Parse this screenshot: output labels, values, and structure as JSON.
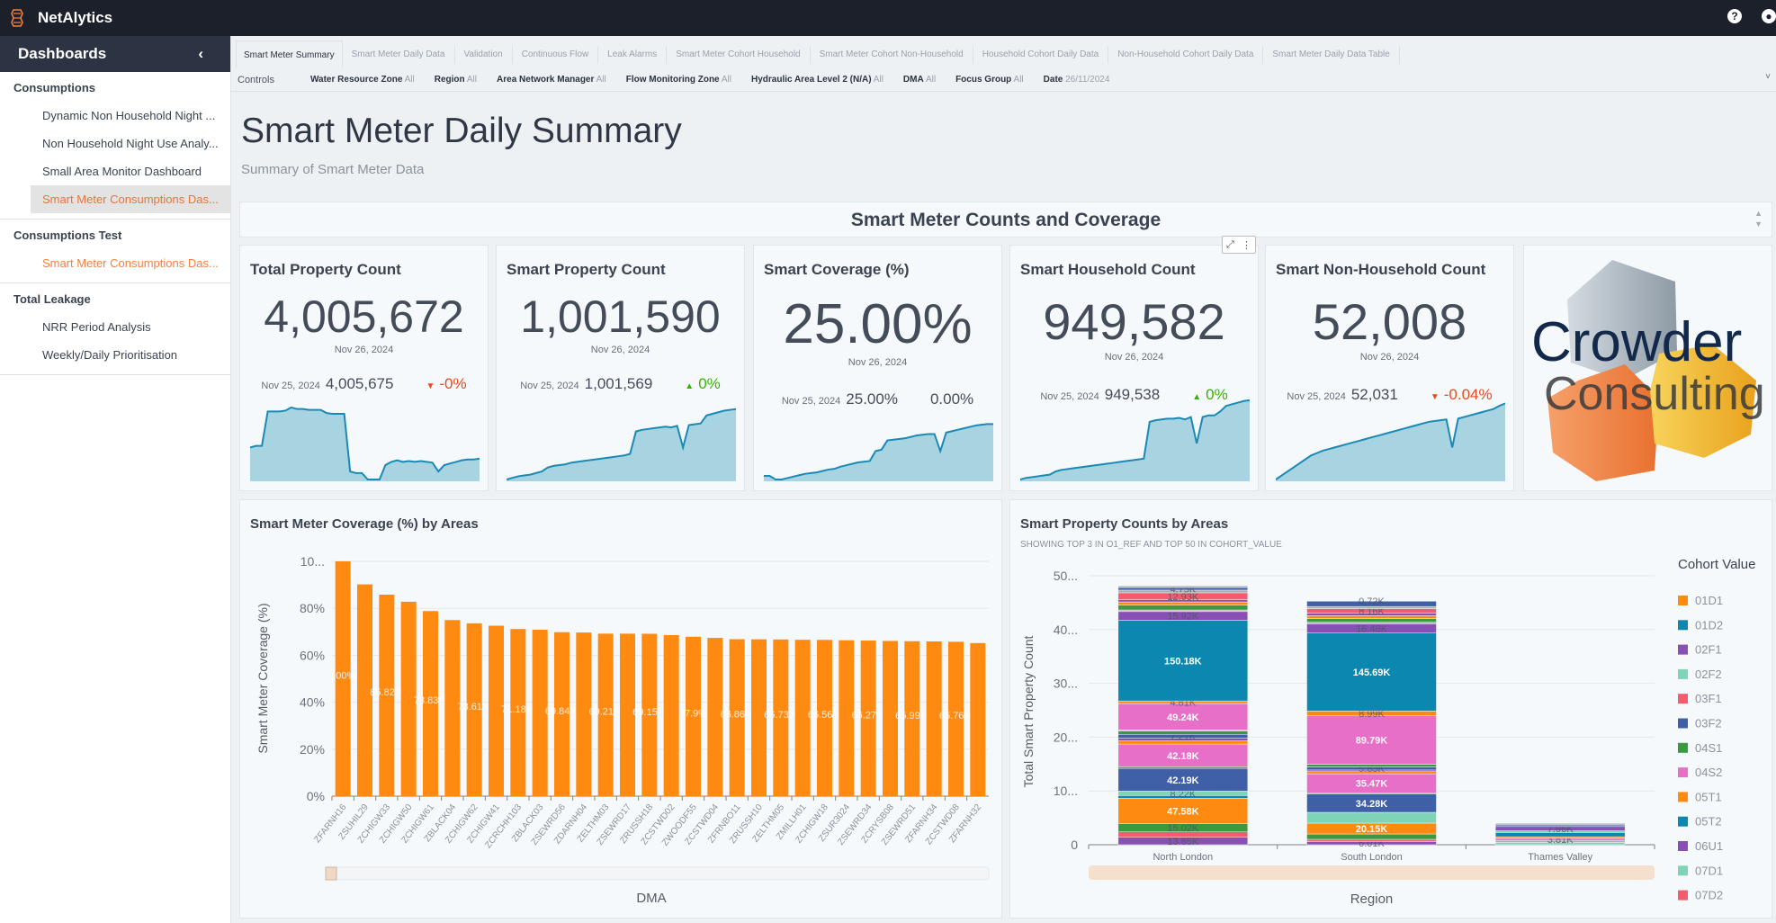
{
  "app": {
    "name": "NetAlytics",
    "help_icon": "question-circle-icon",
    "user_icon": "user-circle-icon"
  },
  "sidebar": {
    "title": "Dashboards",
    "groups": [
      {
        "title": "Consumptions",
        "items": [
          {
            "label": "Dynamic Non Household Night ..."
          },
          {
            "label": "Non Household Night Use Analy..."
          },
          {
            "label": "Small Area Monitor Dashboard"
          },
          {
            "label": "Smart Meter Consumptions Das...",
            "active": true
          }
        ]
      },
      {
        "title": "Consumptions Test",
        "items": [
          {
            "label": "Smart Meter Consumptions Das...",
            "highlight": true
          }
        ]
      },
      {
        "title": "Total Leakage",
        "items": [
          {
            "label": "NRR Period Analysis"
          },
          {
            "label": "Weekly/Daily Prioritisation"
          }
        ]
      }
    ]
  },
  "tabs": [
    {
      "label": "Smart Meter Summary",
      "active": true
    },
    {
      "label": "Smart Meter Daily Data"
    },
    {
      "label": "Validation"
    },
    {
      "label": "Continuous Flow"
    },
    {
      "label": "Leak Alarms"
    },
    {
      "label": "Smart Meter Cohort Household"
    },
    {
      "label": "Smart Meter Cohort Non-Household"
    },
    {
      "label": "Household Cohort Daily Data"
    },
    {
      "label": "Non-Household Cohort Daily Data"
    },
    {
      "label": "Smart Meter Daily Data Table"
    }
  ],
  "controls": {
    "label": "Controls",
    "filters": [
      {
        "name": "Water Resource Zone",
        "value": "All"
      },
      {
        "name": "Region",
        "value": "All"
      },
      {
        "name": "Area Network Manager",
        "value": "All"
      },
      {
        "name": "Flow Monitoring Zone",
        "value": "All"
      },
      {
        "name": "Hydraulic Area Level 2 (N/A)",
        "value": "All"
      },
      {
        "name": "DMA",
        "value": "All"
      },
      {
        "name": "Focus Group",
        "value": "All"
      },
      {
        "name": "Date",
        "value": "26/11/2024"
      }
    ]
  },
  "page": {
    "title": "Smart Meter Daily Summary",
    "subtitle": "Summary of Smart Meter Data",
    "section": "Smart Meter Counts and Coverage"
  },
  "colors": {
    "accent": "#f5803e",
    "spark_line": "#1a8ab5",
    "spark_fill": "#a8d3e0",
    "bar": "#fe8a11",
    "down": "#e8491d",
    "up": "#36b300"
  },
  "kpis": [
    {
      "title": "Total Property Count",
      "value": "4,005,672",
      "date": "Nov 26, 2024",
      "prev_date": "Nov 25, 2024",
      "prev_value": "4,005,675",
      "change": "-0%",
      "dir": "down",
      "trend": [
        40,
        42,
        42,
        85,
        85,
        85,
        86,
        90,
        88,
        88,
        87,
        87,
        87,
        83,
        82,
        82,
        82,
        10,
        8,
        8,
        0,
        0,
        0,
        18,
        22,
        24,
        22,
        23,
        22,
        23,
        22,
        21,
        10,
        18,
        20,
        22,
        24,
        25,
        25,
        26
      ]
    },
    {
      "title": "Smart Property Count",
      "value": "1,001,590",
      "date": "Nov 26, 2024",
      "prev_date": "Nov 25, 2024",
      "prev_value": "1,001,569",
      "change": "0%",
      "dir": "up",
      "trend": [
        0,
        2,
        4,
        5,
        6,
        8,
        10,
        15,
        17,
        18,
        19,
        21,
        22,
        23,
        24,
        25,
        26,
        27,
        28,
        29,
        30,
        32,
        60,
        62,
        63,
        64,
        65,
        66,
        65,
        67,
        40,
        68,
        69,
        70,
        80,
        82,
        84,
        86,
        87,
        88
      ]
    },
    {
      "title": "Smart Coverage (%)",
      "value": "25.00%",
      "date": "Nov 26, 2024",
      "prev_date": "Nov 25, 2024",
      "prev_value": "25.00%",
      "change": "0.00%",
      "dir": "flat",
      "trend": [
        5,
        5,
        0,
        0,
        2,
        4,
        6,
        8,
        9,
        10,
        12,
        14,
        15,
        18,
        20,
        22,
        24,
        25,
        26,
        40,
        42,
        55,
        56,
        57,
        58,
        60,
        62,
        63,
        64,
        64,
        40,
        66,
        68,
        70,
        72,
        74,
        76,
        77,
        78,
        78
      ]
    },
    {
      "title": "Smart Household Count",
      "value": "949,582",
      "date": "Nov 26, 2024",
      "prev_date": "Nov 25, 2024",
      "prev_value": "949,538",
      "change": "0%",
      "dir": "up",
      "trend": [
        0,
        2,
        3,
        4,
        5,
        6,
        10,
        12,
        13,
        14,
        15,
        16,
        17,
        18,
        19,
        20,
        21,
        22,
        23,
        24,
        25,
        26,
        72,
        74,
        75,
        76,
        76,
        77,
        75,
        78,
        45,
        78,
        80,
        80,
        85,
        92,
        94,
        96,
        98,
        99
      ]
    },
    {
      "title": "Smart Non-Household Count",
      "value": "52,008",
      "date": "Nov 26, 2024",
      "prev_date": "Nov 25, 2024",
      "prev_value": "52,031",
      "change": "-0.04%",
      "dir": "down",
      "trend": [
        0,
        5,
        10,
        15,
        20,
        25,
        30,
        33,
        36,
        38,
        40,
        42,
        44,
        46,
        48,
        50,
        52,
        54,
        56,
        58,
        60,
        62,
        64,
        66,
        68,
        70,
        72,
        73,
        74,
        75,
        40,
        76,
        78,
        80,
        82,
        84,
        86,
        88,
        92,
        95
      ]
    }
  ],
  "logo": {
    "text_line1": "Crowder",
    "text_line2": "Consulting"
  },
  "chart_data": [
    {
      "type": "bar",
      "title": "Smart Meter Coverage (%) by Areas",
      "xlabel": "DMA",
      "ylabel": "Smart Meter Coverage (%)",
      "ylim": [
        0,
        100
      ],
      "yticks": [
        "0%",
        "20%",
        "40%",
        "60%",
        "80%",
        "10..."
      ],
      "grid": true,
      "categories": [
        "ZFARNH16",
        "ZSUHIL29",
        "ZCHIGW33",
        "ZCHIGW50",
        "ZCHIGW61",
        "ZBLACK04",
        "ZCHIGW62",
        "ZCHIGW41",
        "ZCRCHH103",
        "ZBLACK03",
        "ZSEWRD56",
        "ZDARNH04",
        "ZELTHM03",
        "ZSEWRD17",
        "ZRUSSH18",
        "ZCSTWD02",
        "ZWOODF55",
        "ZCSTWD04",
        "ZFRNBO11",
        "ZRUSSH10",
        "ZELTHM05",
        "ZMILLH01",
        "ZCHIGW18",
        "ZSUR3024",
        "ZSEWRD34",
        "ZCRYSB08",
        "ZSEWRD51",
        "ZFARNH34",
        "ZCSTWD08",
        "ZFARNH32"
      ],
      "values": [
        100,
        90.2,
        85.82,
        82.8,
        78.83,
        75.0,
        73.61,
        72.6,
        71.18,
        70.9,
        69.84,
        69.7,
        69.21,
        69.2,
        69.15,
        68.6,
        67.9,
        67.4,
        66.86,
        66.8,
        66.73,
        66.6,
        66.56,
        66.4,
        66.27,
        66.1,
        65.99,
        65.9,
        65.76,
        65.2
      ],
      "data_labels": [
        "100%",
        "",
        "85.82%",
        "",
        "78.83%",
        "",
        "73.61%",
        "",
        "71.18%",
        "",
        "69.84%",
        "",
        "69.21%",
        "",
        "69.15%",
        "",
        "67.9%",
        "",
        "66.86%",
        "",
        "66.73%",
        "",
        "66.56%",
        "",
        "66.27%",
        "",
        "65.99%",
        "",
        "65.76%",
        ""
      ]
    },
    {
      "type": "bar",
      "stacked": true,
      "title": "Smart Property Counts by Areas",
      "subtitle": "SHOWING TOP 3 IN O1_REF AND TOP 50 IN COHORT_VALUE",
      "xlabel": "Region",
      "ylabel": "Total Smart Property Count",
      "ylim": [
        0,
        500000
      ],
      "yticks": [
        "0",
        "10...",
        "20...",
        "30...",
        "40...",
        "50..."
      ],
      "grid": true,
      "legend": {
        "title": "Cohort Value",
        "position": "right"
      },
      "cohorts": [
        {
          "name": "01D1",
          "color": "#fe8a11"
        },
        {
          "name": "01D2",
          "color": "#0c87b0"
        },
        {
          "name": "02F1",
          "color": "#8a4fb5"
        },
        {
          "name": "02F2",
          "color": "#7fd4b8"
        },
        {
          "name": "03F1",
          "color": "#f45b6c"
        },
        {
          "name": "03F2",
          "color": "#3f5fa7"
        },
        {
          "name": "04S1",
          "color": "#3a9a3e"
        },
        {
          "name": "04S2",
          "color": "#e86fc8"
        },
        {
          "name": "05T1",
          "color": "#fe8a11"
        },
        {
          "name": "05T2",
          "color": "#0c87b0"
        },
        {
          "name": "06U1",
          "color": "#8a4fb5"
        },
        {
          "name": "07D1",
          "color": "#7fd4b8"
        },
        {
          "name": "07D2",
          "color": "#f45b6c"
        }
      ],
      "other_color": "#a9aeb5",
      "categories": [
        "North London",
        "South London",
        "Thames Valley"
      ],
      "segments": [
        [
          [
            "02F1",
            13850,
            "13.85K"
          ],
          [
            "03F1",
            10000
          ],
          [
            "04S1",
            15020,
            "15.02K"
          ],
          [
            "05T1",
            47580,
            "47.58K"
          ],
          [
            "05T2",
            5000
          ],
          [
            "02F2",
            8220,
            "8.22K"
          ],
          [
            "03F2",
            42190,
            "42.19K"
          ],
          [
            "04S1",
            3000
          ],
          [
            "04S2",
            42180,
            "42.18K"
          ],
          [
            "01D1",
            6000
          ],
          [
            "06U1",
            5000
          ],
          [
            "03F2",
            7210,
            "7.21K"
          ],
          [
            "04S1",
            6000
          ],
          [
            null,
            2000
          ],
          [
            "04S2",
            49240,
            "49.24K"
          ],
          [
            "01D1",
            4810,
            "4.81K"
          ],
          [
            "01D2",
            150180,
            "150.18K"
          ],
          [
            "02F1",
            15920,
            "15.92K"
          ],
          [
            null,
            3000
          ],
          [
            "04S1",
            9000
          ],
          [
            "05T1",
            6000
          ],
          [
            "06U1",
            4000
          ],
          [
            "03F1",
            12930,
            "12.93K"
          ],
          [
            null,
            5000
          ],
          [
            "03F2",
            4750,
            "4.75K"
          ],
          [
            null,
            3000
          ]
        ],
        [
          [
            "06U1",
            6010,
            "6.01K"
          ],
          [
            "03F1",
            4000
          ],
          [
            "04S1",
            10000
          ],
          [
            "05T1",
            20150,
            "20.15K"
          ],
          [
            "07D1",
            20000
          ],
          [
            "03F2",
            34280,
            "34.28K"
          ],
          [
            "04S1",
            2000
          ],
          [
            "04S2",
            35470,
            "35.47K"
          ],
          [
            "01D1",
            4000
          ],
          [
            "02F1",
            3000
          ],
          [
            "03F2",
            5830,
            "5.83K"
          ],
          [
            "04S1",
            5000
          ],
          [
            "04S2",
            89790,
            "89.79K"
          ],
          [
            "01D1",
            8990,
            "8.99K"
          ],
          [
            "01D2",
            145690,
            "145.69K"
          ],
          [
            "02F1",
            16480,
            "16.48K"
          ],
          [
            null,
            3000
          ],
          [
            "04S1",
            7000
          ],
          [
            "05T1",
            5000
          ],
          [
            "06U1",
            5000
          ],
          [
            "03F1",
            8160,
            "8.16K"
          ],
          [
            null,
            4000
          ],
          [
            "03F2",
            10000
          ],
          [
            null,
            720,
            "0.72K"
          ]
        ],
        [
          [
            "07D1",
            4000
          ],
          [
            null,
            4000
          ],
          [
            "04S2",
            3810,
            "3.81K"
          ],
          [
            "01D1",
            3000
          ],
          [
            "01D2",
            8000
          ],
          [
            "02F2",
            3000
          ],
          [
            "06U1",
            7960,
            "7.96K"
          ],
          [
            "03F2",
            3000
          ],
          [
            null,
            3000
          ]
        ]
      ]
    }
  ]
}
